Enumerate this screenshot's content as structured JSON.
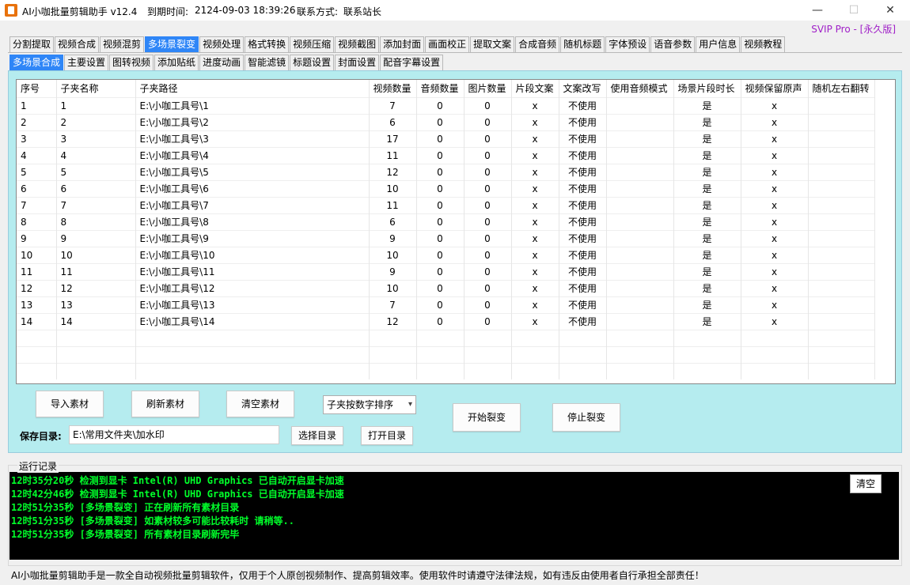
{
  "window": {
    "title": "AI小咖批量剪辑助手 v12.4",
    "expire_label": "到期时间:",
    "expire_value": "2124-09-03 18:39:26",
    "contact_label": "联系方式:",
    "contact_value": "联系站长",
    "minimize": "—",
    "maximize": "☐",
    "close": "✕"
  },
  "svip": "SVIP Pro - [永久版]",
  "main_tabs": [
    "分割提取",
    "视频合成",
    "视频混剪",
    "多场景裂变",
    "视频处理",
    "格式转换",
    "视频压缩",
    "视频截图",
    "添加封面",
    "画面校正",
    "提取文案",
    "合成音频",
    "随机标题",
    "字体预设",
    "语音参数",
    "用户信息",
    "视频教程"
  ],
  "main_tab_active": 3,
  "sub_tabs": [
    "多场景合成",
    "主要设置",
    "图转视频",
    "添加贴纸",
    "进度动画",
    "智能滤镜",
    "标题设置",
    "封面设置",
    "配音字幕设置"
  ],
  "sub_tab_active": 0,
  "table": {
    "columns": [
      "序号",
      "子夹名称",
      "子夹路径",
      "视频数量",
      "音频数量",
      "图片数量",
      "片段文案",
      "文案改写",
      "使用音频模式",
      "场景片段时长",
      "视频保留原声",
      "随机左右翻转"
    ],
    "rows": [
      [
        "1",
        "1",
        "E:\\小咖工具号\\1",
        "7",
        "0",
        "0",
        "x",
        "不使用",
        "",
        "是",
        "x",
        ""
      ],
      [
        "2",
        "2",
        "E:\\小咖工具号\\2",
        "6",
        "0",
        "0",
        "x",
        "不使用",
        "",
        "是",
        "x",
        ""
      ],
      [
        "3",
        "3",
        "E:\\小咖工具号\\3",
        "17",
        "0",
        "0",
        "x",
        "不使用",
        "",
        "是",
        "x",
        ""
      ],
      [
        "4",
        "4",
        "E:\\小咖工具号\\4",
        "11",
        "0",
        "0",
        "x",
        "不使用",
        "",
        "是",
        "x",
        ""
      ],
      [
        "5",
        "5",
        "E:\\小咖工具号\\5",
        "12",
        "0",
        "0",
        "x",
        "不使用",
        "",
        "是",
        "x",
        ""
      ],
      [
        "6",
        "6",
        "E:\\小咖工具号\\6",
        "10",
        "0",
        "0",
        "x",
        "不使用",
        "",
        "是",
        "x",
        ""
      ],
      [
        "7",
        "7",
        "E:\\小咖工具号\\7",
        "11",
        "0",
        "0",
        "x",
        "不使用",
        "",
        "是",
        "x",
        ""
      ],
      [
        "8",
        "8",
        "E:\\小咖工具号\\8",
        "6",
        "0",
        "0",
        "x",
        "不使用",
        "",
        "是",
        "x",
        ""
      ],
      [
        "9",
        "9",
        "E:\\小咖工具号\\9",
        "9",
        "0",
        "0",
        "x",
        "不使用",
        "",
        "是",
        "x",
        ""
      ],
      [
        "10",
        "10",
        "E:\\小咖工具号\\10",
        "10",
        "0",
        "0",
        "x",
        "不使用",
        "",
        "是",
        "x",
        ""
      ],
      [
        "11",
        "11",
        "E:\\小咖工具号\\11",
        "9",
        "0",
        "0",
        "x",
        "不使用",
        "",
        "是",
        "x",
        ""
      ],
      [
        "12",
        "12",
        "E:\\小咖工具号\\12",
        "10",
        "0",
        "0",
        "x",
        "不使用",
        "",
        "是",
        "x",
        ""
      ],
      [
        "13",
        "13",
        "E:\\小咖工具号\\13",
        "7",
        "0",
        "0",
        "x",
        "不使用",
        "",
        "是",
        "x",
        ""
      ],
      [
        "14",
        "14",
        "E:\\小咖工具号\\14",
        "12",
        "0",
        "0",
        "x",
        "不使用",
        "",
        "是",
        "x",
        ""
      ]
    ]
  },
  "buttons": {
    "import": "导入素材",
    "refresh": "刷新素材",
    "clear_material": "清空素材",
    "sort_select": "子夹按数字排序",
    "start": "开始裂变",
    "stop": "停止裂变",
    "choose_dir": "选择目录",
    "open_dir": "打开目录",
    "clear_log": "清空"
  },
  "save_dir": {
    "label": "保存目录:",
    "value": "E:\\常用文件夹\\加水印"
  },
  "log": {
    "title": "运行记录",
    "lines": [
      "12时35分20秒 检测到显卡 Intel(R) UHD Graphics 已自动开启显卡加速",
      "12时42分46秒 检测到显卡 Intel(R) UHD Graphics 已自动开启显卡加速",
      "12时51分35秒 [多场景裂变] 正在刷新所有素材目录",
      "12时51分35秒 [多场景裂变] 如素材较多可能比较耗时 请稍等..",
      "12时51分35秒 [多场景裂变] 所有素材目录刷新完毕"
    ]
  },
  "footer": "AI小咖批量剪辑助手是一款全自动视频批量剪辑软件，仅用于个人原创视频制作、提高剪辑效率。使用软件时请遵守法律法规，如有违反由使用者自行承担全部责任！"
}
